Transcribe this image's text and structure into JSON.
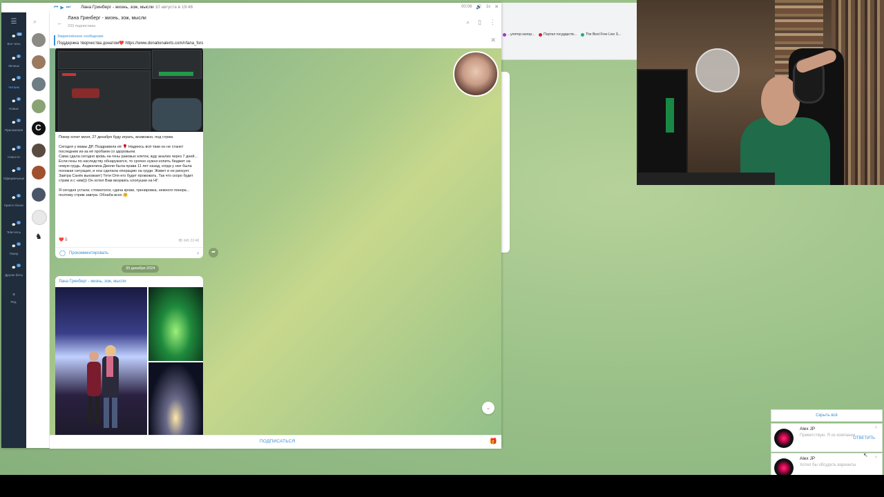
{
  "titlebar": {
    "now_playing": "Лана Гринберг - жизнь, зож, мысли",
    "now_playing_date": "10 августа в 19:46",
    "time": "00:08"
  },
  "sidebar": {
    "items": [
      {
        "label": "Все чаты",
        "badge": "99"
      },
      {
        "label": "Личные",
        "badge": "2"
      },
      {
        "label": "Читаем",
        "badge": "1"
      },
      {
        "label": "Новые",
        "badge": "3"
      },
      {
        "label": "Приложения",
        "badge": "2"
      },
      {
        "label": "Новости",
        "badge": "2"
      },
      {
        "label": "Официальные",
        "badge": "1"
      },
      {
        "label": "Крипто блоги",
        "badge": "5"
      },
      {
        "label": "Telегчаты",
        "badge": "1"
      },
      {
        "label": "Покер",
        "badge": "1"
      },
      {
        "label": "Другие беты",
        "badge": "1"
      },
      {
        "label": "Ред.",
        "badge": ""
      }
    ]
  },
  "chat": {
    "name": "Лана Гринберг - жизнь, зож, мысли",
    "subscribers": "233 подписчика",
    "pinned_title": "Закреплённое сообщение",
    "pinned_text": "Поддержка творчества донатом❤️ https://www.donationalerts.com/r/lana_fors",
    "message_text": "Покер хочет меня, 27 декабря буду играть, возможно, под стрим.\n\nСегодня у мамы ДР. Поздравила её 🌹 Надеюсь всё-таки он не станет последним из-за её пробаем со здоровьем.\nСама сдала сегодня кровь на гены раковых клеток, жду анализ через 7 дней... Если гены по наследству обнаружатся, то срочно нужно копить бюджет на новую грудь. Анджелина Джоли была права 11 лет назад, когда у нее была похожая ситуация, и она сделала операцию на груди. Живет и не рискует.\nЗавтра Санёк выезжает) Тети Оля его будет провожать. Так что скоро будет стрим и с ним))) Он хотел Вам вкорвать хлопушки на НГ.\n\nЯ сегодня устала: стоматолог, сдача крови, тренировка, немного покера... поэтому стрим завтра. Обнаба всех 🤗",
    "reactions": "❤️ 5",
    "views": "645",
    "time": "22:48",
    "comment_label": "Прокомментировать",
    "date_pill": "30 декабря 2024",
    "author": "Лана Гринберг - жизнь, зож, мысли",
    "subscribe_label": "ПОДПИСАТЬСЯ"
  },
  "browser": {
    "bookmarks": [
      "...улятор калор...",
      "Портал государств...",
      "The Best Free Live S..."
    ]
  },
  "notifications": {
    "hide_all": "Скрыть всё",
    "items": [
      {
        "name": "Alex JP",
        "text": "Приветствую. Я из компании",
        "reply": "ОТВЕТИТЬ"
      },
      {
        "name": "Alex JP",
        "text": "Хотел бы обсудить варианты",
        "reply": ""
      }
    ]
  },
  "colors": {
    "accent": "#3a8ed6",
    "sidebar": "#1f2d3d"
  }
}
